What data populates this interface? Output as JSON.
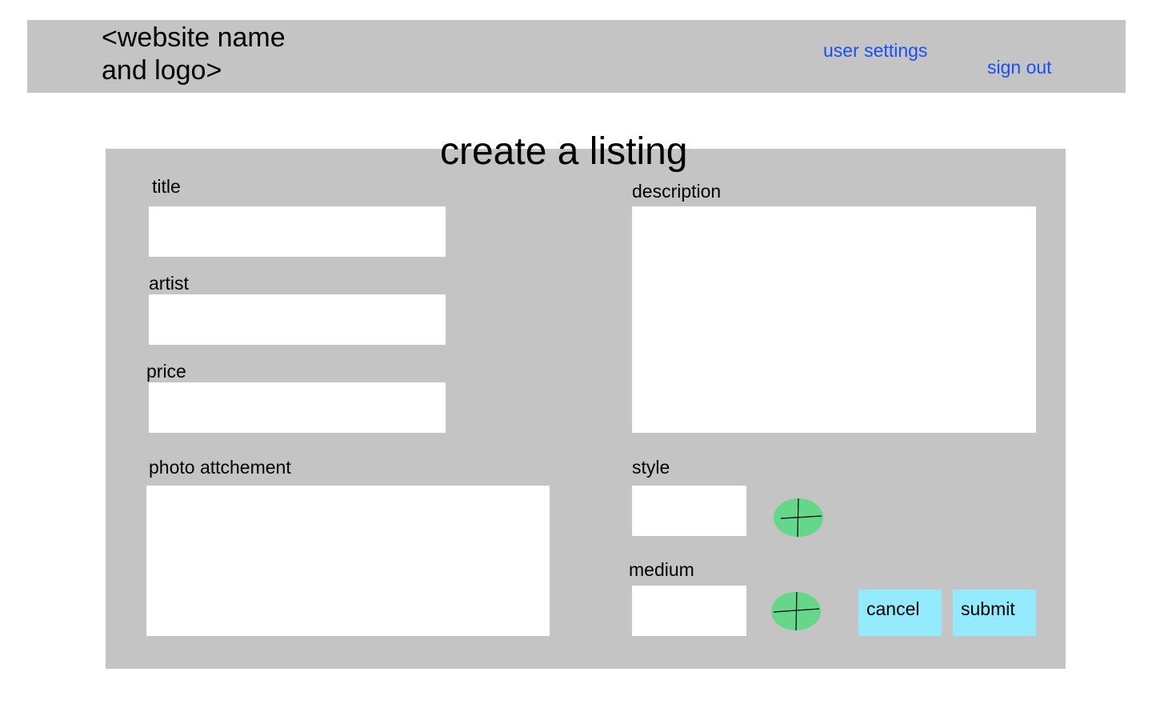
{
  "header": {
    "site_name": "<website name\nand logo>",
    "user_settings_label": "user settings",
    "sign_out_label": "sign out"
  },
  "page": {
    "title": "create a listing"
  },
  "form": {
    "title_label": "title",
    "artist_label": "artist",
    "price_label": "price",
    "description_label": "description",
    "photo_label": "photo attchement",
    "style_label": "style",
    "medium_label": "medium",
    "cancel_label": "cancel",
    "submit_label": "submit"
  },
  "icons": {
    "add_style": "plus-icon",
    "add_medium": "plus-icon"
  },
  "colors": {
    "header_bg": "#c4c4c4",
    "panel_bg": "#c4c4c4",
    "link": "#1b4ff0",
    "add_button": "#66d68b",
    "action_button": "#93eafd"
  }
}
